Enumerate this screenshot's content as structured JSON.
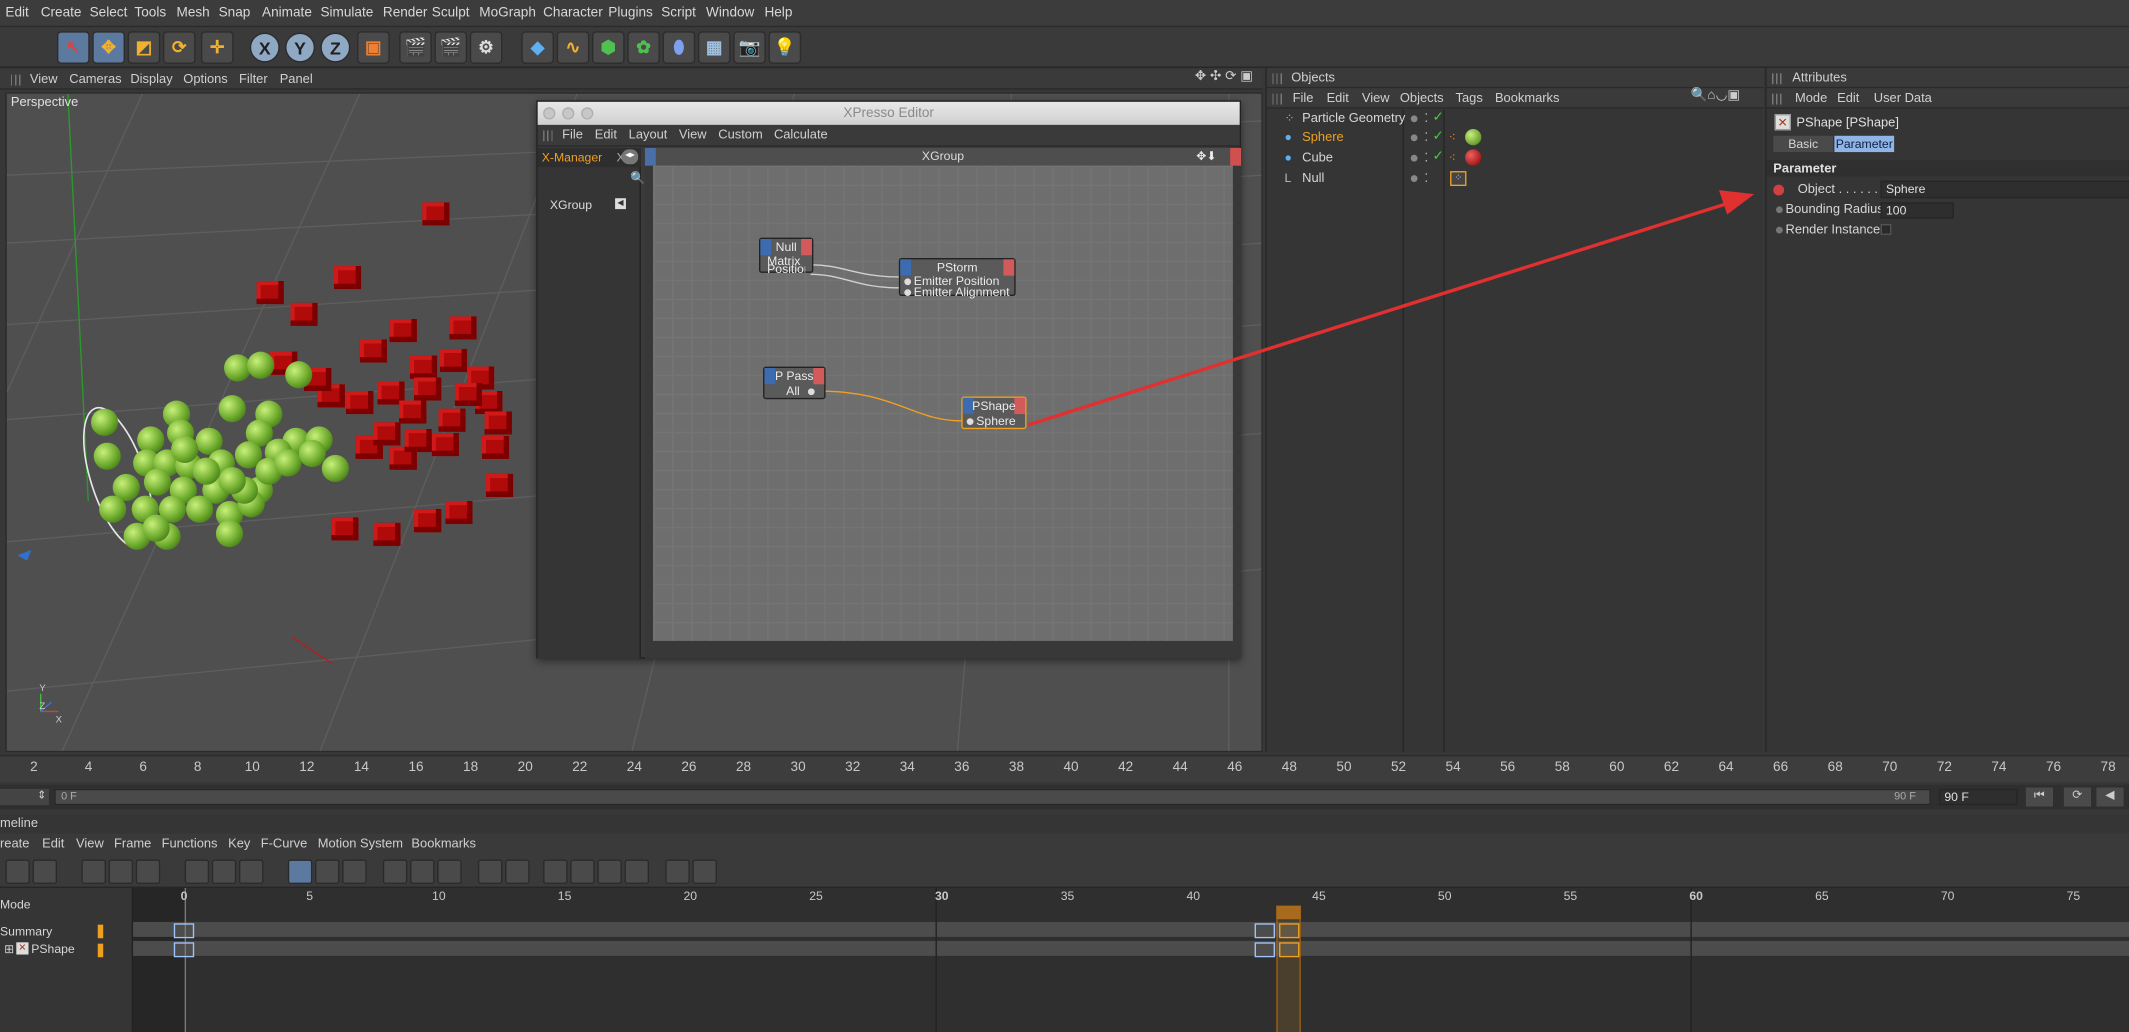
{
  "menubar": {
    "items": [
      "Edit",
      "Create",
      "Select",
      "Tools",
      "Mesh",
      "Snap",
      "Animate",
      "Simulate",
      "Render",
      "Sculpt",
      "MoGraph",
      "Character",
      "Plugins",
      "Script",
      "Window",
      "Help"
    ]
  },
  "viewport": {
    "menu": [
      "View",
      "Cameras",
      "Display",
      "Options",
      "Filter",
      "Panel"
    ],
    "label": "Perspective"
  },
  "axes": {
    "x": "X",
    "y": "Y",
    "z": "Z"
  },
  "xpresso": {
    "title": "XPresso Editor",
    "menu": [
      "File",
      "Edit",
      "Layout",
      "View",
      "Custom",
      "Calculate"
    ],
    "xmanager_tab": "X-Manager",
    "xmanager_tab2": "X",
    "tree_item": "XGroup",
    "canvas_title": "XGroup",
    "nodes": {
      "null": {
        "title": "Null",
        "ports": [
          "Matrix",
          "Position"
        ]
      },
      "pstorm": {
        "title": "PStorm",
        "ports": [
          "Emitter Position",
          "Emitter Alignment"
        ]
      },
      "ppass": {
        "title": "P Pass",
        "ports": [
          "All"
        ]
      },
      "pshape": {
        "title": "PShape",
        "ports": [
          "Sphere"
        ]
      }
    }
  },
  "objects": {
    "title": "Objects",
    "menu": [
      "File",
      "Edit",
      "View",
      "Objects",
      "Tags",
      "Bookmarks"
    ],
    "rows": [
      {
        "name": "Particle Geometry",
        "color": "#d6d6d6"
      },
      {
        "name": "Sphere",
        "color": "#f0a020"
      },
      {
        "name": "Cube",
        "color": "#d6d6d6"
      },
      {
        "name": "Null",
        "color": "#d6d6d6"
      }
    ]
  },
  "attributes": {
    "title": "Attributes",
    "menu": [
      "Mode",
      "Edit",
      "User Data"
    ],
    "object_name": "PShape [PShape]",
    "tabs": [
      "Basic",
      "Parameter"
    ],
    "section": "Parameter",
    "fields": {
      "object_label": "Object . . . . . . . .",
      "object_value": "Sphere",
      "radius_label": "Bounding Radius",
      "radius_value": "100",
      "render_label": "Render Instance"
    }
  },
  "ruler": {
    "ticks": [
      "2",
      "4",
      "6",
      "8",
      "10",
      "12",
      "14",
      "16",
      "18",
      "20",
      "22",
      "24",
      "26",
      "28",
      "30",
      "32",
      "34",
      "36",
      "38",
      "40",
      "42",
      "44",
      "46",
      "48",
      "50",
      "52",
      "54",
      "56",
      "58",
      "60",
      "62",
      "64",
      "66",
      "68",
      "70",
      "72",
      "74",
      "76",
      "78"
    ]
  },
  "slider": {
    "start": "0 F",
    "end": "90 F",
    "end_field": "90 F"
  },
  "timeline": {
    "title": "meline",
    "menu": [
      "reate",
      "Edit",
      "View",
      "Frame",
      "Functions",
      "Key",
      "F-Curve",
      "Motion System",
      "Bookmarks"
    ],
    "mode": "Mode",
    "rows": [
      "Summary",
      "PShape"
    ],
    "ticks": [
      "0",
      "5",
      "10",
      "15",
      "20",
      "25",
      "30",
      "35",
      "40",
      "45",
      "50",
      "55",
      "60",
      "65",
      "70",
      "75"
    ]
  }
}
